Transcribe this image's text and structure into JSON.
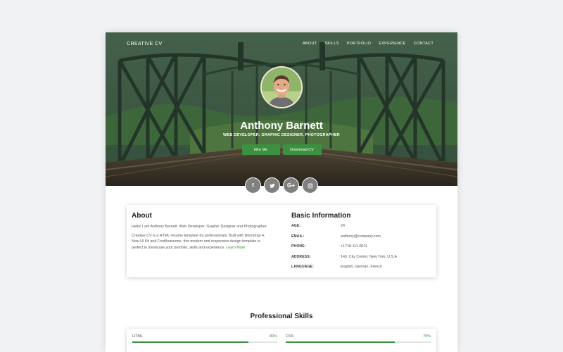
{
  "nav": {
    "brand": "CREATIVE CV",
    "links": [
      "ABOUT",
      "SKILLS",
      "PORTFOLIO",
      "EXPERIENCE",
      "CONTACT"
    ]
  },
  "hero": {
    "name": "Anthony Barnett",
    "tagline": "WEB DEVELOPER, GRAPHIC DESIGNER, PHOTOGRAPHER",
    "hire_label": "Hire Me",
    "download_label": "Download CV"
  },
  "social": [
    {
      "icon": "facebook-icon",
      "glyph": "f"
    },
    {
      "icon": "twitter-icon",
      "glyph": "t"
    },
    {
      "icon": "google-plus-icon",
      "glyph": "G+"
    },
    {
      "icon": "instagram-icon",
      "glyph": "◎"
    }
  ],
  "about": {
    "title": "About",
    "p1": "Hello! I am Anthony Barnett. Web Developer, Graphic Designer and Photographer.",
    "p2": "Creative CV is a HTML resume template for professionals. Built with Bootstrap 4, Now UI Kit and FontAwesome, this modern and responsive design template is perfect to showcase your portfolio, skills and experience.",
    "learn_more": "Learn More"
  },
  "basic": {
    "title": "Basic Information",
    "rows": [
      {
        "k": "AGE:",
        "v": "24"
      },
      {
        "k": "EMAIL:",
        "v": "anthony@company.com"
      },
      {
        "k": "PHONE:",
        "v": "+1718-111-0011"
      },
      {
        "k": "ADDRESS:",
        "v": "140, City Center, New York, U.S.A"
      },
      {
        "k": "LANGUAGE:",
        "v": "English, German, French"
      }
    ]
  },
  "skills": {
    "title": "Professional Skills",
    "items": [
      {
        "name": "HTML",
        "percent": 80,
        "label": "80%"
      },
      {
        "name": "CSS",
        "percent": 75,
        "label": "75%"
      }
    ]
  },
  "colors": {
    "accent": "#3b9140",
    "social_bg": "#808080"
  }
}
